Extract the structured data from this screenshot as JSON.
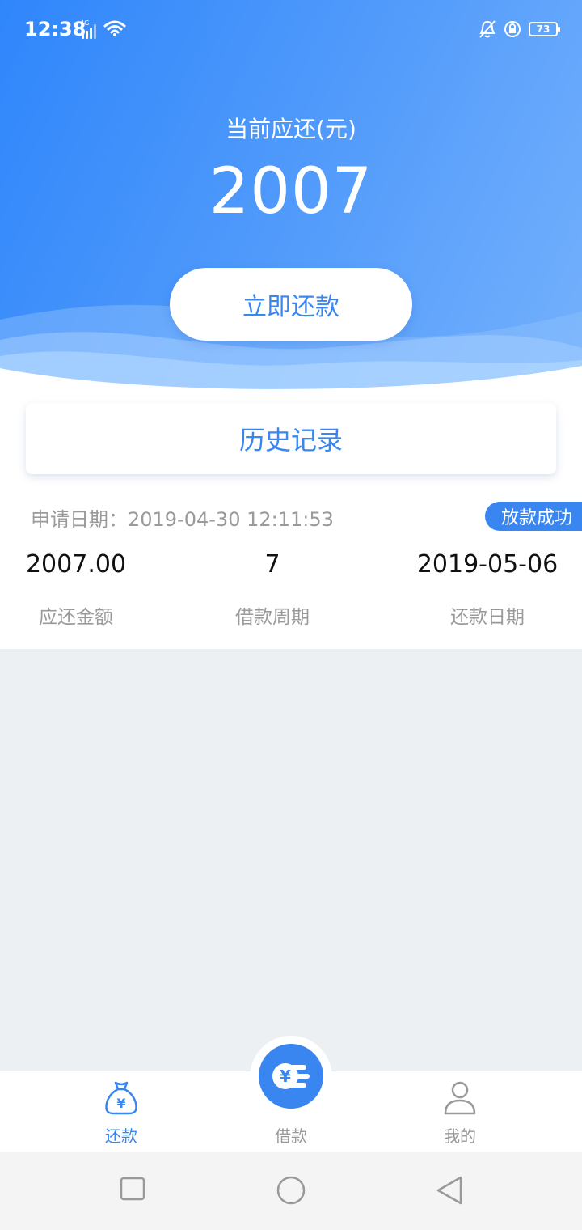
{
  "status_bar": {
    "time": "12:38",
    "network": "4G",
    "battery": "73"
  },
  "header": {
    "due_label": "当前应还(元)",
    "due_amount": "2007",
    "repay_button": "立即还款"
  },
  "history": {
    "title": "历史记录",
    "apply_date": "申请日期：2019-04-30 12:11:53",
    "status_badge": "放款成功",
    "amount_value": "2007.00",
    "amount_label": "应还金额",
    "period_value": "7",
    "period_label": "借款周期",
    "repay_date_value": "2019-05-06",
    "repay_date_label": "还款日期"
  },
  "tabs": [
    {
      "label": "还款",
      "icon": "money-bag-icon",
      "active": true
    },
    {
      "label": "借款",
      "icon": "yuan-coin-icon",
      "active": false
    },
    {
      "label": "我的",
      "icon": "person-icon",
      "active": false
    }
  ],
  "colors": {
    "accent": "#3a86f0",
    "header_start": "#2f86fb",
    "header_end": "#75b1fc"
  }
}
